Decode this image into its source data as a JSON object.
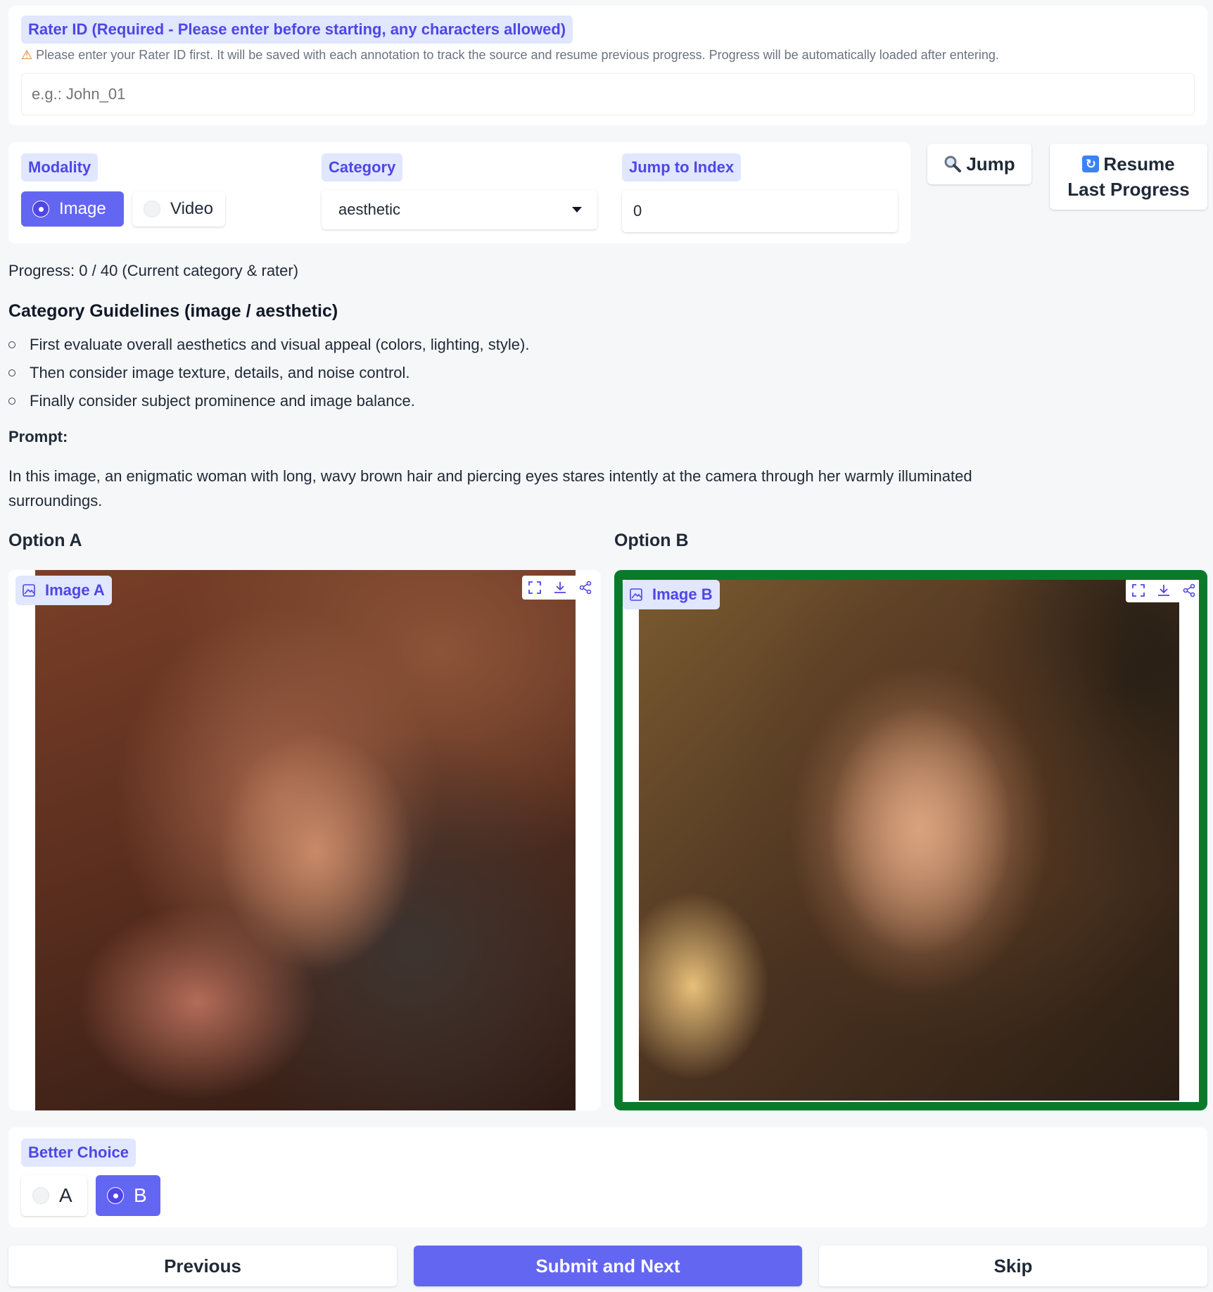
{
  "rater": {
    "label": "Rater ID (Required - Please enter before starting, any characters allowed)",
    "warning_icon": "warning-icon",
    "warning": "Please enter your Rater ID first. It will be saved with each annotation to track the source and resume previous progress. Progress will be automatically loaded after entering.",
    "placeholder": "e.g.: John_01",
    "value": ""
  },
  "modality": {
    "label": "Modality",
    "options": [
      "Image",
      "Video"
    ],
    "selected": "Image"
  },
  "category": {
    "label": "Category",
    "value": "aesthetic"
  },
  "jump_index": {
    "label": "Jump to Index",
    "value": "0"
  },
  "buttons": {
    "jump": "Jump",
    "jump_icon": "magnifier-icon",
    "resume_line1": "Resume",
    "resume_line2": "Last Progress",
    "resume_icon": "refresh-icon",
    "previous": "Previous",
    "submit": "Submit and Next",
    "skip": "Skip"
  },
  "progress": "Progress: 0 / 40 (Current category & rater)",
  "guidelines": {
    "title": "Category Guidelines (image / aesthetic)",
    "items": [
      "First evaluate overall aesthetics and visual appeal (colors, lighting, style).",
      "Then consider image texture, details, and noise control.",
      "Finally consider subject prominence and image balance."
    ]
  },
  "prompt": {
    "label": "Prompt:",
    "text_line1": "In this image, an enigmatic woman with long, wavy brown hair and piercing eyes stares intently at the camera through her warmly illuminated",
    "text_line2": "surroundings."
  },
  "options": {
    "a_title": "Option A",
    "b_title": "Option B",
    "a_image_label": "Image A",
    "b_image_label": "Image B",
    "selected_border_color": "#0a7a2a"
  },
  "better_choice": {
    "label": "Better Choice",
    "options": [
      "A",
      "B"
    ],
    "selected": "B"
  },
  "colors": {
    "accent": "#6366f1",
    "accent_text": "#4f46e5",
    "chip_bg": "#e0e7ff",
    "page_bg": "#f6f7f9"
  }
}
